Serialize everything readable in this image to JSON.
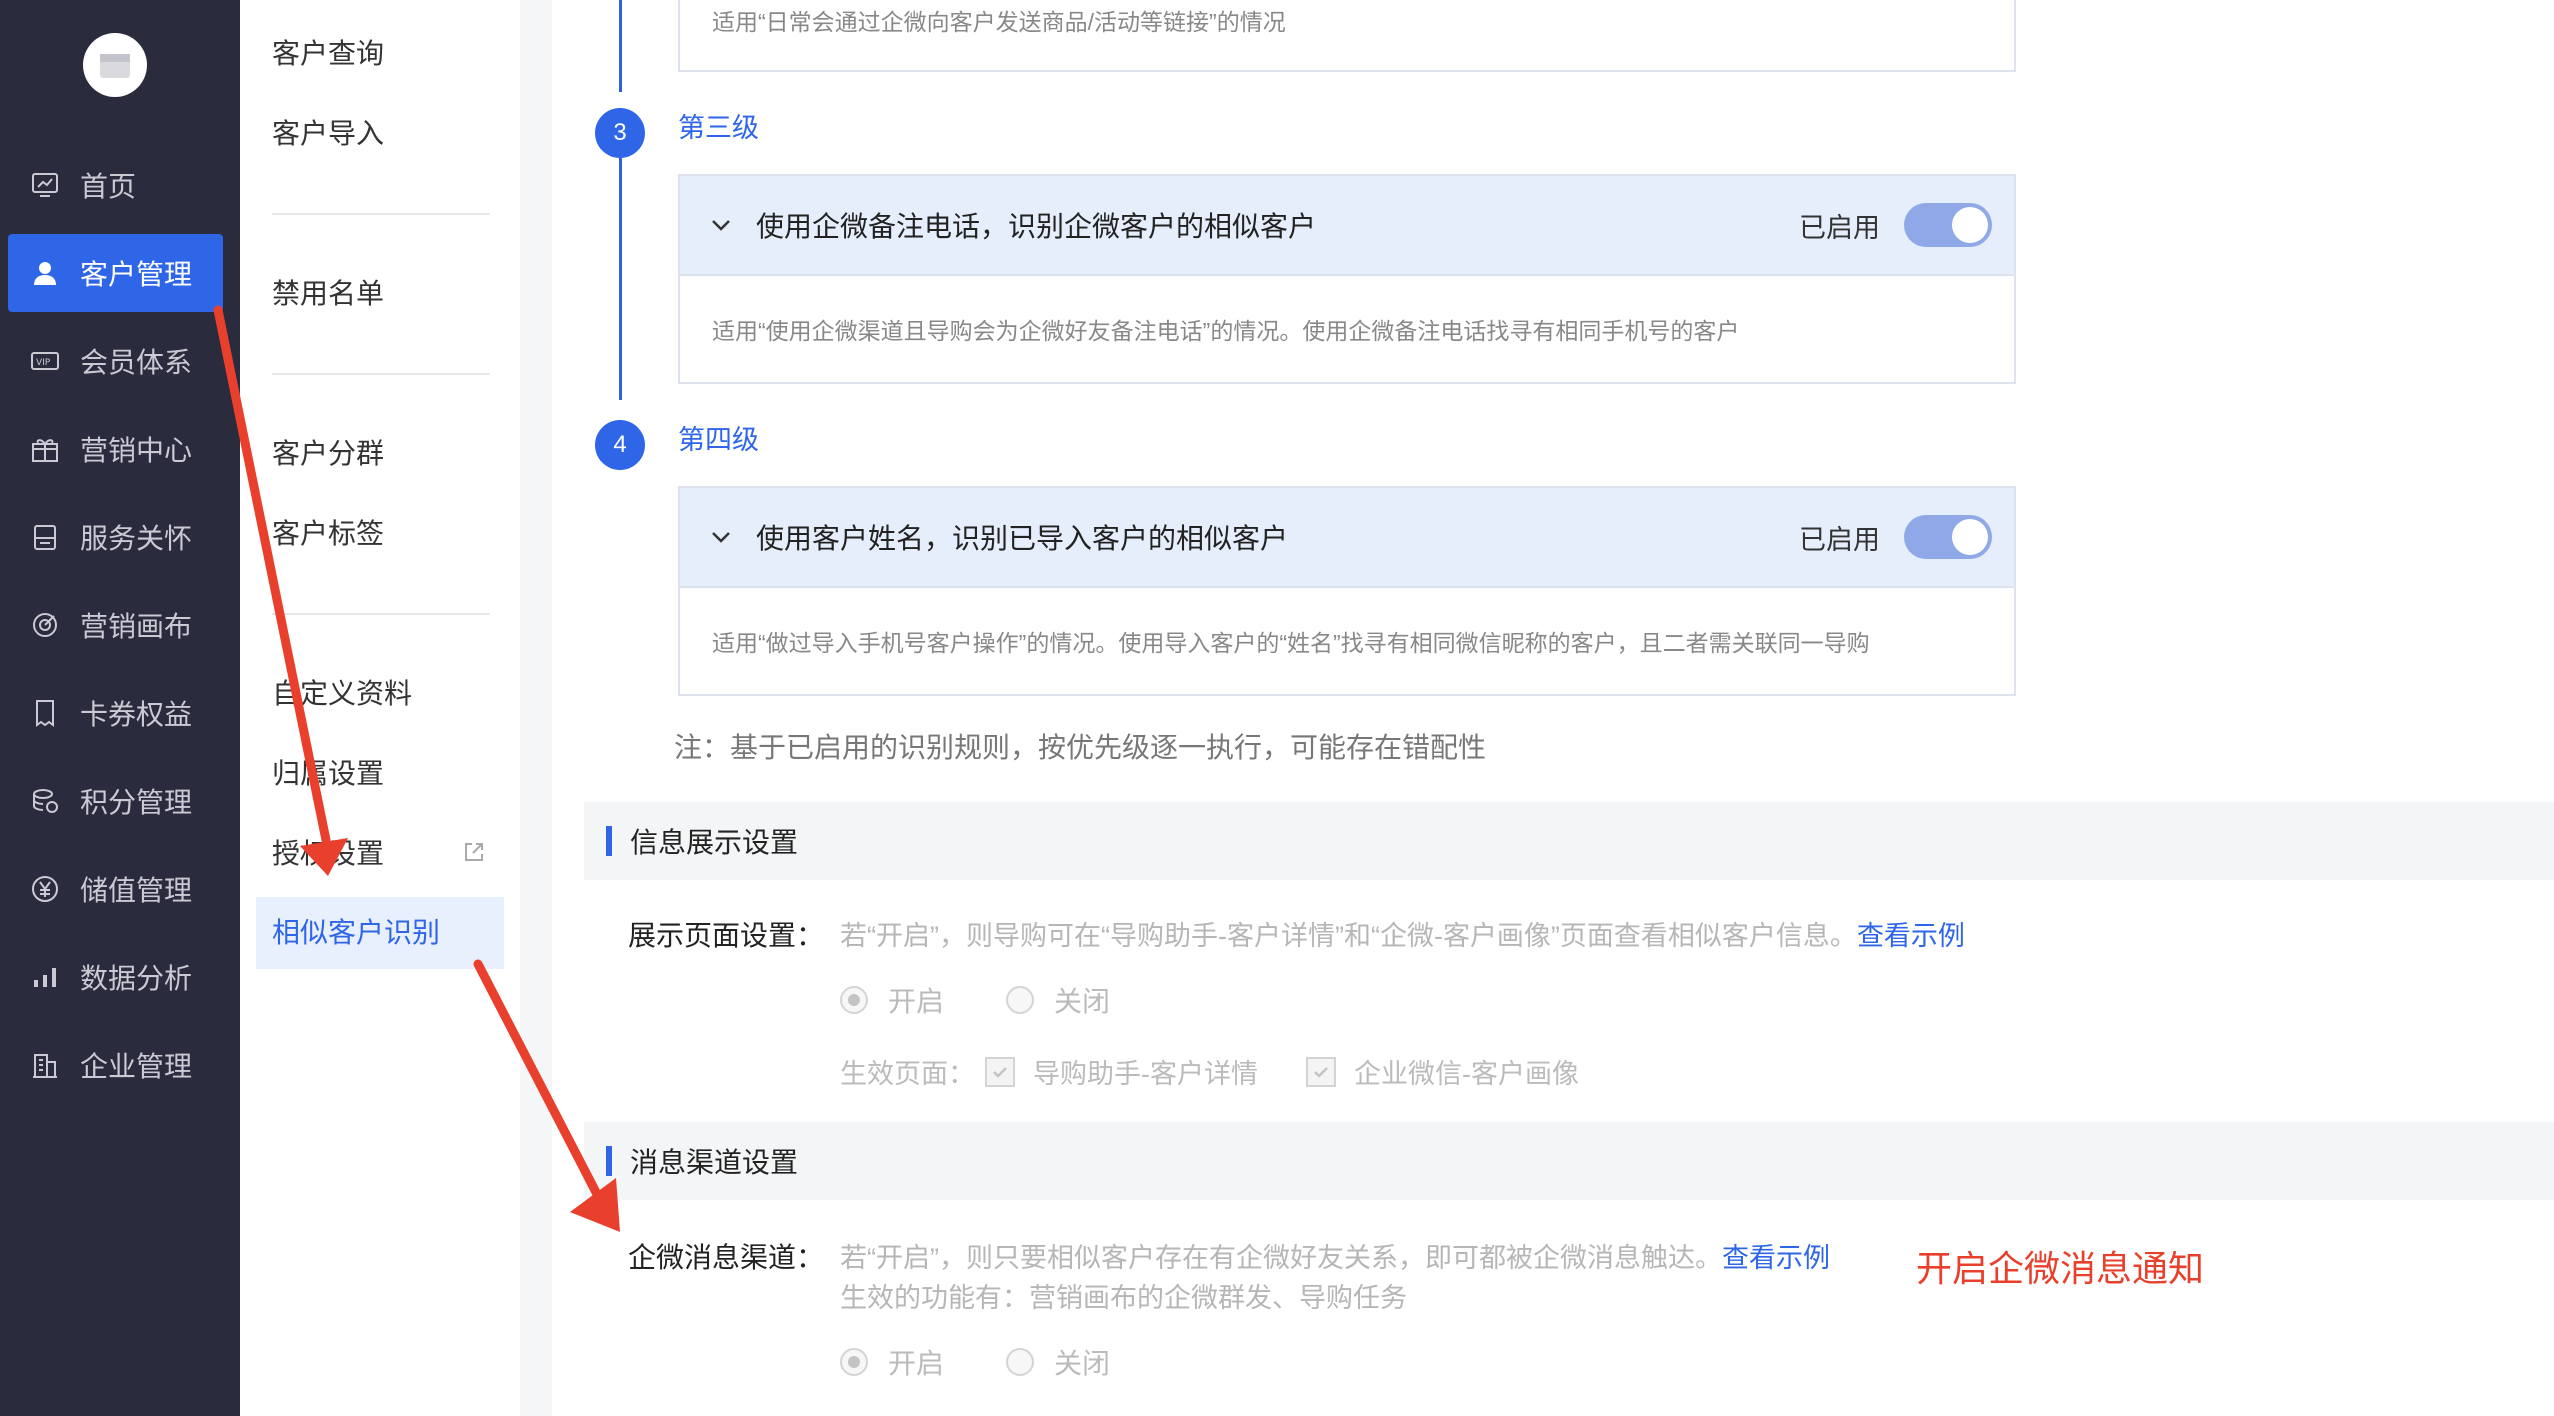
{
  "nav": {
    "items": [
      {
        "label": "首页",
        "icon": "dashboard-icon"
      },
      {
        "label": "客户管理",
        "icon": "user-icon",
        "active": true
      },
      {
        "label": "会员体系",
        "icon": "vip-icon"
      },
      {
        "label": "营销中心",
        "icon": "gift-icon"
      },
      {
        "label": "服务关怀",
        "icon": "service-icon"
      },
      {
        "label": "营销画布",
        "icon": "canvas-icon"
      },
      {
        "label": "卡券权益",
        "icon": "coupon-icon"
      },
      {
        "label": "积分管理",
        "icon": "points-icon"
      },
      {
        "label": "储值管理",
        "icon": "yen-icon"
      },
      {
        "label": "数据分析",
        "icon": "chart-icon"
      },
      {
        "label": "企业管理",
        "icon": "building-icon"
      }
    ]
  },
  "submenu": {
    "items": [
      "客户查询",
      "客户导入",
      "禁用名单",
      "客户分群",
      "客户标签",
      "自定义资料",
      "归属设置",
      "授权设置",
      "相似客户识别"
    ],
    "active": "相似客户识别"
  },
  "main": {
    "top_card_desc": "适用“日常会通过企微向客户发送商品/活动等链接”的情况",
    "levels": [
      {
        "step": "3",
        "title": "第三级",
        "rule": "使用企微备注电话，识别企微客户的相似客户",
        "status": "已启用",
        "desc": "适用“使用企微渠道且导购会为企微好友备注电话”的情况。使用企微备注电话找寻有相同手机号的客户"
      },
      {
        "step": "4",
        "title": "第四级",
        "rule": "使用客户姓名，识别已导入客户的相似客户",
        "status": "已启用",
        "desc": "适用“做过导入手机号客户操作”的情况。使用导入客户的“姓名”找寻有相同微信昵称的客户，且二者需关联同一导购"
      }
    ],
    "note": "注：基于已启用的识别规则，按优先级逐一执行，可能存在错配性",
    "info_section": {
      "title": "信息展示设置",
      "label": "展示页面设置：",
      "desc": "若“开启”，则导购可在“导购助手-客户详情”和“企微-客户画像”页面查看相似客户信息。",
      "link": "查看示例",
      "radio_on": "开启",
      "radio_off": "关闭",
      "effective_label": "生效页面：",
      "check1": "导购助手-客户详情",
      "check2": "企业微信-客户画像"
    },
    "msg_section": {
      "title": "消息渠道设置",
      "label": "企微消息渠道：",
      "desc": "若“开启”，则只要相似客户存在有企微好友关系，即可都被企微消息触达。",
      "link": "查看示例",
      "desc2": "生效的功能有：营销画布的企微群发、导购任务",
      "radio_on": "开启",
      "radio_off": "关闭"
    },
    "annotation": "开启企微消息通知"
  },
  "colors": {
    "nav_bg": "#2a2b3c",
    "accent": "#2f66e8",
    "annotation": "#e8402c"
  }
}
